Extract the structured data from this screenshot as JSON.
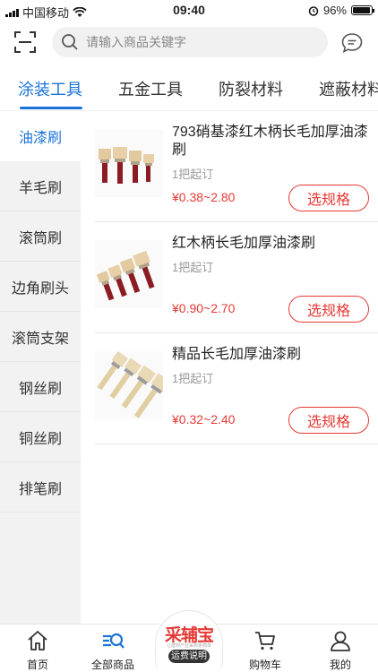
{
  "status_bar": {
    "carrier": "中国移动",
    "time": "09:40",
    "battery": "96%",
    "battery_level": 0.96
  },
  "search": {
    "placeholder": "请输入商品关键字"
  },
  "category_tabs": [
    {
      "label": "涂装工具",
      "active": true
    },
    {
      "label": "五金工具",
      "active": false
    },
    {
      "label": "防裂材料",
      "active": false
    },
    {
      "label": "遮蔽材料",
      "active": false
    }
  ],
  "sidebar": {
    "items": [
      {
        "label": "油漆刷",
        "active": true
      },
      {
        "label": "羊毛刷",
        "active": false
      },
      {
        "label": "滚筒刷",
        "active": false
      },
      {
        "label": "边角刷头",
        "active": false
      },
      {
        "label": "滚筒支架",
        "active": false
      },
      {
        "label": "钢丝刷",
        "active": false
      },
      {
        "label": "铜丝刷",
        "active": false
      },
      {
        "label": "排笔刷",
        "active": false
      }
    ]
  },
  "products": [
    {
      "name": "793硝基漆红木柄长毛加厚油漆刷",
      "moq": "1把起订",
      "price": "¥0.38~2.80",
      "button": "选规格"
    },
    {
      "name": "红木柄长毛加厚油漆刷",
      "moq": "1把起订",
      "price": "¥0.90~2.70",
      "button": "选规格"
    },
    {
      "name": "精品长毛加厚油漆刷",
      "moq": "1把起订",
      "price": "¥0.32~2.40",
      "button": "选规格"
    }
  ],
  "bottom_nav": {
    "home": "首页",
    "all_products": "全部商品",
    "brand": "采辅宝",
    "brand_slogan": "让建材产业采购更简单",
    "shipping": "运费说明",
    "cart": "购物车",
    "mine": "我的"
  },
  "colors": {
    "accent": "#1a73d9",
    "price": "#e53935"
  }
}
